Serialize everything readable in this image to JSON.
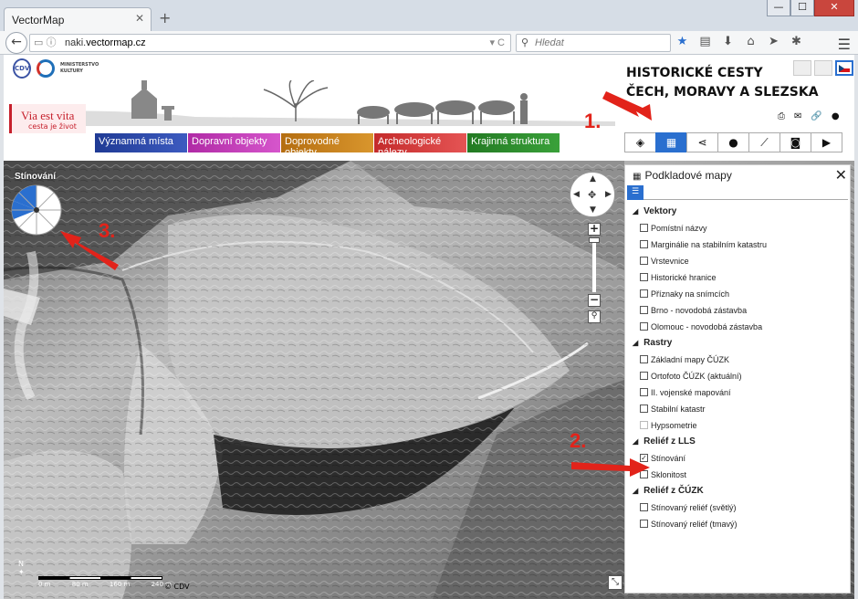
{
  "browser": {
    "tab_title": "VectorMap",
    "tab_close": "✕",
    "new_tab": "+",
    "url_prefix": "naki.",
    "url_domain": "vectormap.cz",
    "url_suffix": "",
    "search_placeholder": "Hledat",
    "win_min": "—",
    "win_max": "☐",
    "win_close": "✕"
  },
  "header": {
    "title_line1": "HISTORICKÉ CESTY",
    "title_line2": "ČECH, MORAVY A SLEZSKA",
    "via_line1": "Via est vita",
    "via_line2": "cesta je život",
    "ministry_text": "MINISTERSTVO KULTURY",
    "cdv_text": "CDV"
  },
  "categories": [
    {
      "label": "Významná místa",
      "color": "#2b4aa6"
    },
    {
      "label": "Dopravní objekty",
      "color": "#c23fb8"
    },
    {
      "label": "Doprovodné objekty",
      "color": "#c77f1c"
    },
    {
      "label": "Archeologické nálezy",
      "color": "#d63a3a"
    },
    {
      "label": "Krajinná struktura",
      "color": "#2f8a2f"
    }
  ],
  "tools": [
    "layers-icon",
    "basemap-icon",
    "network-icon",
    "comment-icon",
    "measure-icon",
    "camera-icon",
    "video-icon"
  ],
  "map": {
    "shading_label": "Stínování",
    "scale_labels": [
      "0 m",
      "80 m",
      "160 m",
      "240 m"
    ],
    "copyright": "© CDV",
    "north": "N"
  },
  "panel": {
    "title": "Podkladové mapy",
    "close": "✕",
    "groups": [
      {
        "label": "Vektory",
        "items": [
          {
            "label": "Pomístní názvy",
            "checked": false
          },
          {
            "label": "Marginálie na stabilním katastru",
            "checked": false
          },
          {
            "label": "Vrstevnice",
            "checked": false
          },
          {
            "label": "Historické hranice",
            "checked": false
          },
          {
            "label": "Příznaky na snímcích",
            "checked": false
          },
          {
            "label": "Brno - novodobá zástavba",
            "checked": false
          },
          {
            "label": "Olomouc - novodobá zástavba",
            "checked": false
          }
        ]
      },
      {
        "label": "Rastry",
        "items": [
          {
            "label": "Základní mapy ČÚZK",
            "checked": false
          },
          {
            "label": "Ortofoto ČÚZK (aktuální)",
            "checked": false
          },
          {
            "label": "II. vojenské mapování",
            "checked": false
          },
          {
            "label": "Stabilní katastr",
            "checked": false
          },
          {
            "label": "Hypsometrie",
            "checked": false,
            "dim": true
          }
        ]
      },
      {
        "label": "Reliéf z LLS",
        "items": [
          {
            "label": "Stínování",
            "checked": true
          },
          {
            "label": "Sklonitost",
            "checked": false
          }
        ]
      },
      {
        "label": "Reliéf z ČÚZK",
        "items": [
          {
            "label": "Stínovaný reliéf (světlý)",
            "checked": false
          },
          {
            "label": "Stínovaný reliéf (tmavý)",
            "checked": false
          }
        ]
      }
    ]
  },
  "annotations": {
    "n1": "1.",
    "n2": "2.",
    "n3": "3.",
    "arrow_color": "#e2231a"
  }
}
